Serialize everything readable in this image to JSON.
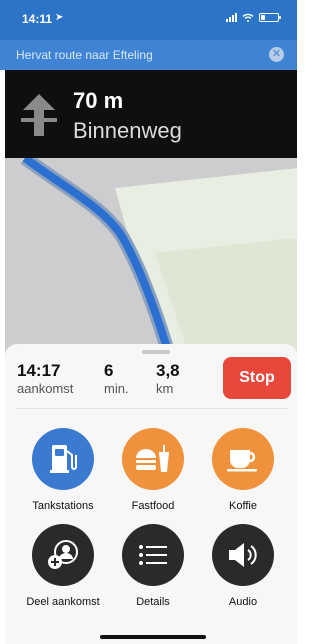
{
  "status_bar": {
    "time": "14:11",
    "location_icon": "location-arrow-icon",
    "icons": [
      "signal-icon",
      "wifi-icon",
      "battery-icon"
    ]
  },
  "resume_bar": {
    "label": "Hervat route naar Efteling",
    "close_icon": "close-icon"
  },
  "direction": {
    "icon": "straight-arrow-icon",
    "distance": "70 m",
    "street": "Binnenweg"
  },
  "trip": {
    "arrival_value": "14:17",
    "arrival_label": "aankomst",
    "minutes_value": "6",
    "minutes_label": "min.",
    "distance_value": "3,8",
    "distance_label": "km",
    "stop_label": "Stop"
  },
  "actions": [
    {
      "label": "Tankstations",
      "icon": "fuel-pump-icon",
      "color": "#3a7ad1"
    },
    {
      "label": "Fastfood",
      "icon": "burger-drink-icon",
      "color": "#f0923b"
    },
    {
      "label": "Koffie",
      "icon": "coffee-cup-icon",
      "color": "#f0923b"
    },
    {
      "label": "Deel aankomst",
      "icon": "share-arrival-icon",
      "color": "#2a2a2a"
    },
    {
      "label": "Details",
      "icon": "list-icon",
      "color": "#2a2a2a"
    },
    {
      "label": "Audio",
      "icon": "speaker-icon",
      "color": "#2a2a2a"
    }
  ],
  "colors": {
    "route": "#2b6fd1",
    "stop": "#e8473c",
    "accent": "#3f84d4"
  }
}
